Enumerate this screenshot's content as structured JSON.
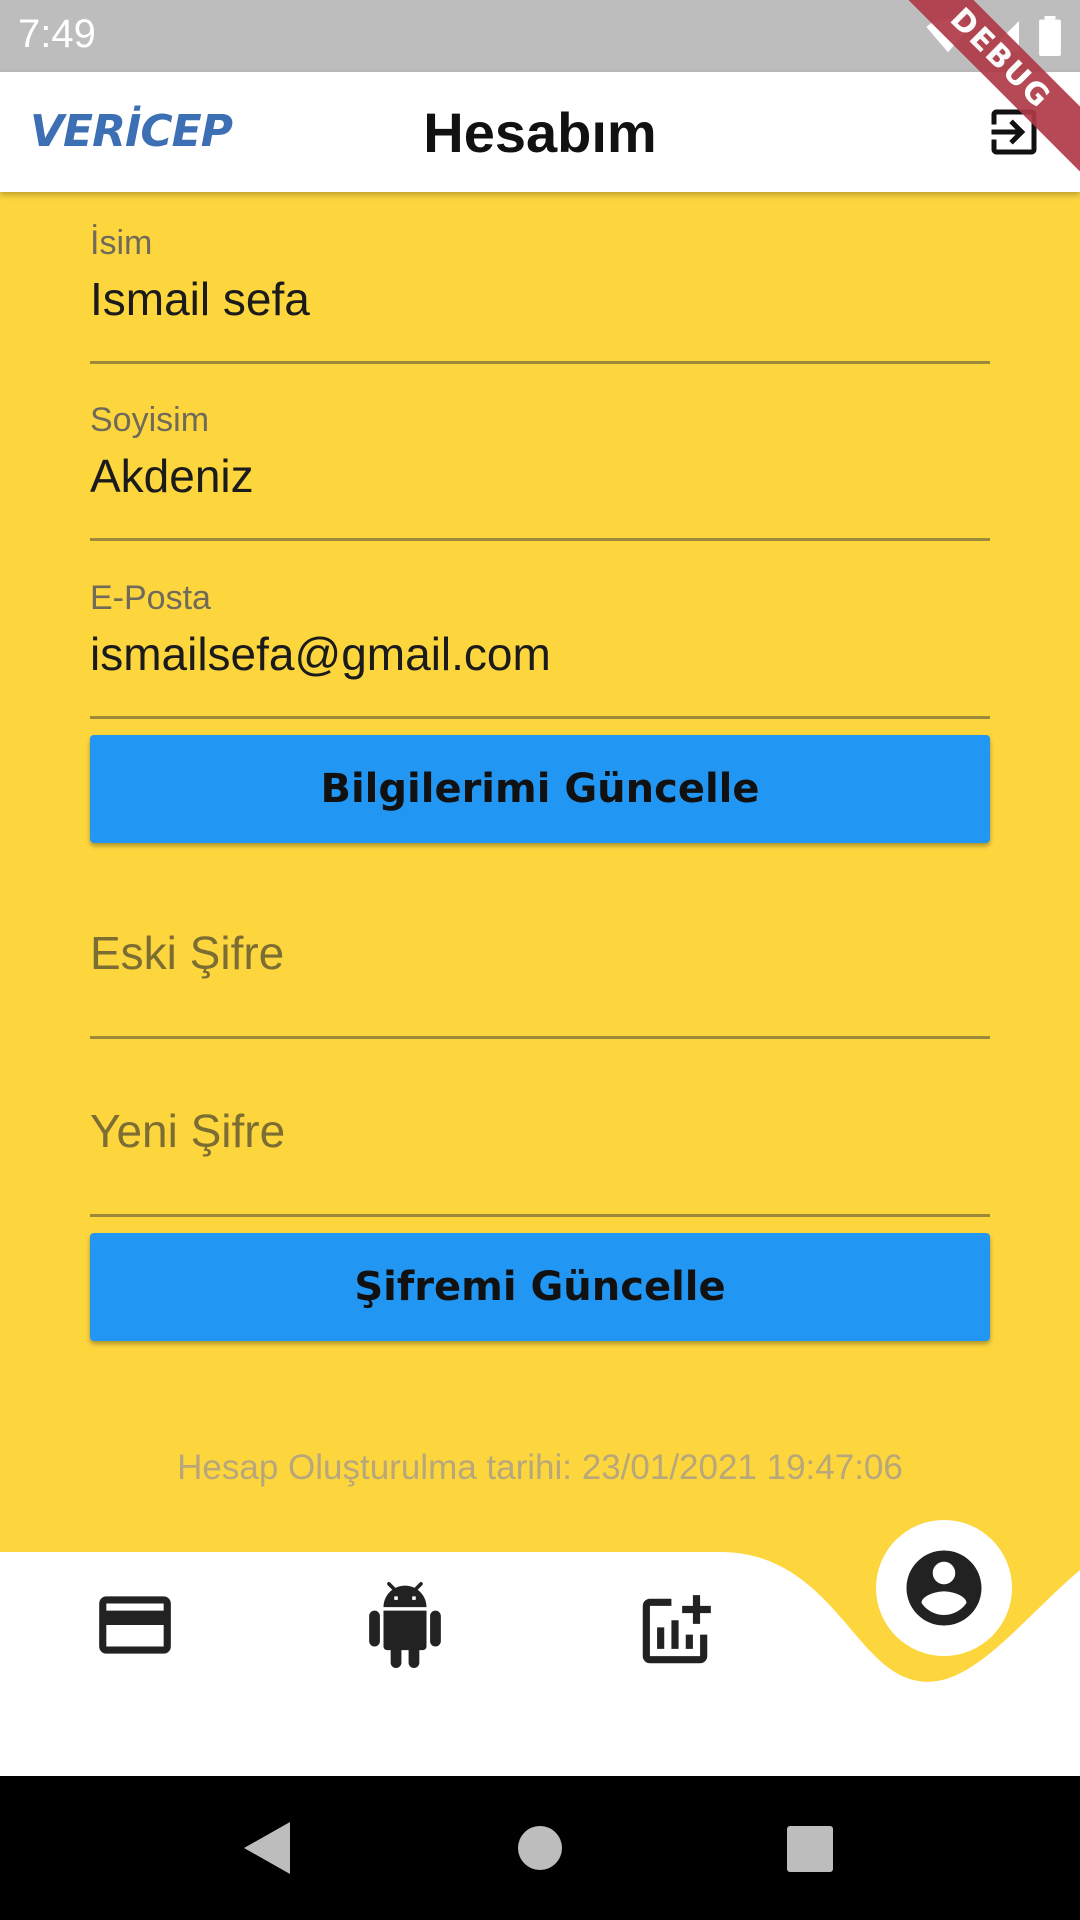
{
  "status_bar": {
    "time": "7:49"
  },
  "debug_banner": "DEBUG",
  "app_bar": {
    "logo": "VERİCEP",
    "title": "Hesabım"
  },
  "profile_form": {
    "name": {
      "label": "İsim",
      "value": "Ismail sefa"
    },
    "surname": {
      "label": "Soyisim",
      "value": "Akdeniz"
    },
    "email": {
      "label": "E-Posta",
      "value": "ismailsefa@gmail.com"
    },
    "update_button": "Bilgilerimi Güncelle"
  },
  "password_form": {
    "old_password_placeholder": "Eski Şifre",
    "new_password_placeholder": "Yeni Şifre",
    "update_button": "Şifremi Güncelle"
  },
  "created_at": "Hesap Oluşturulma tarihi: 23/01/2021 19:47:06",
  "bottom_nav": {
    "items": [
      {
        "icon": "credit-card-icon"
      },
      {
        "icon": "android-icon"
      },
      {
        "icon": "add-chart-icon"
      },
      {
        "icon": "account-circle-icon",
        "active": true
      }
    ]
  },
  "colors": {
    "background": "#FDD63E",
    "button": "#2196F3",
    "logo": "#3D6FB4",
    "debug": "#B03A48"
  }
}
